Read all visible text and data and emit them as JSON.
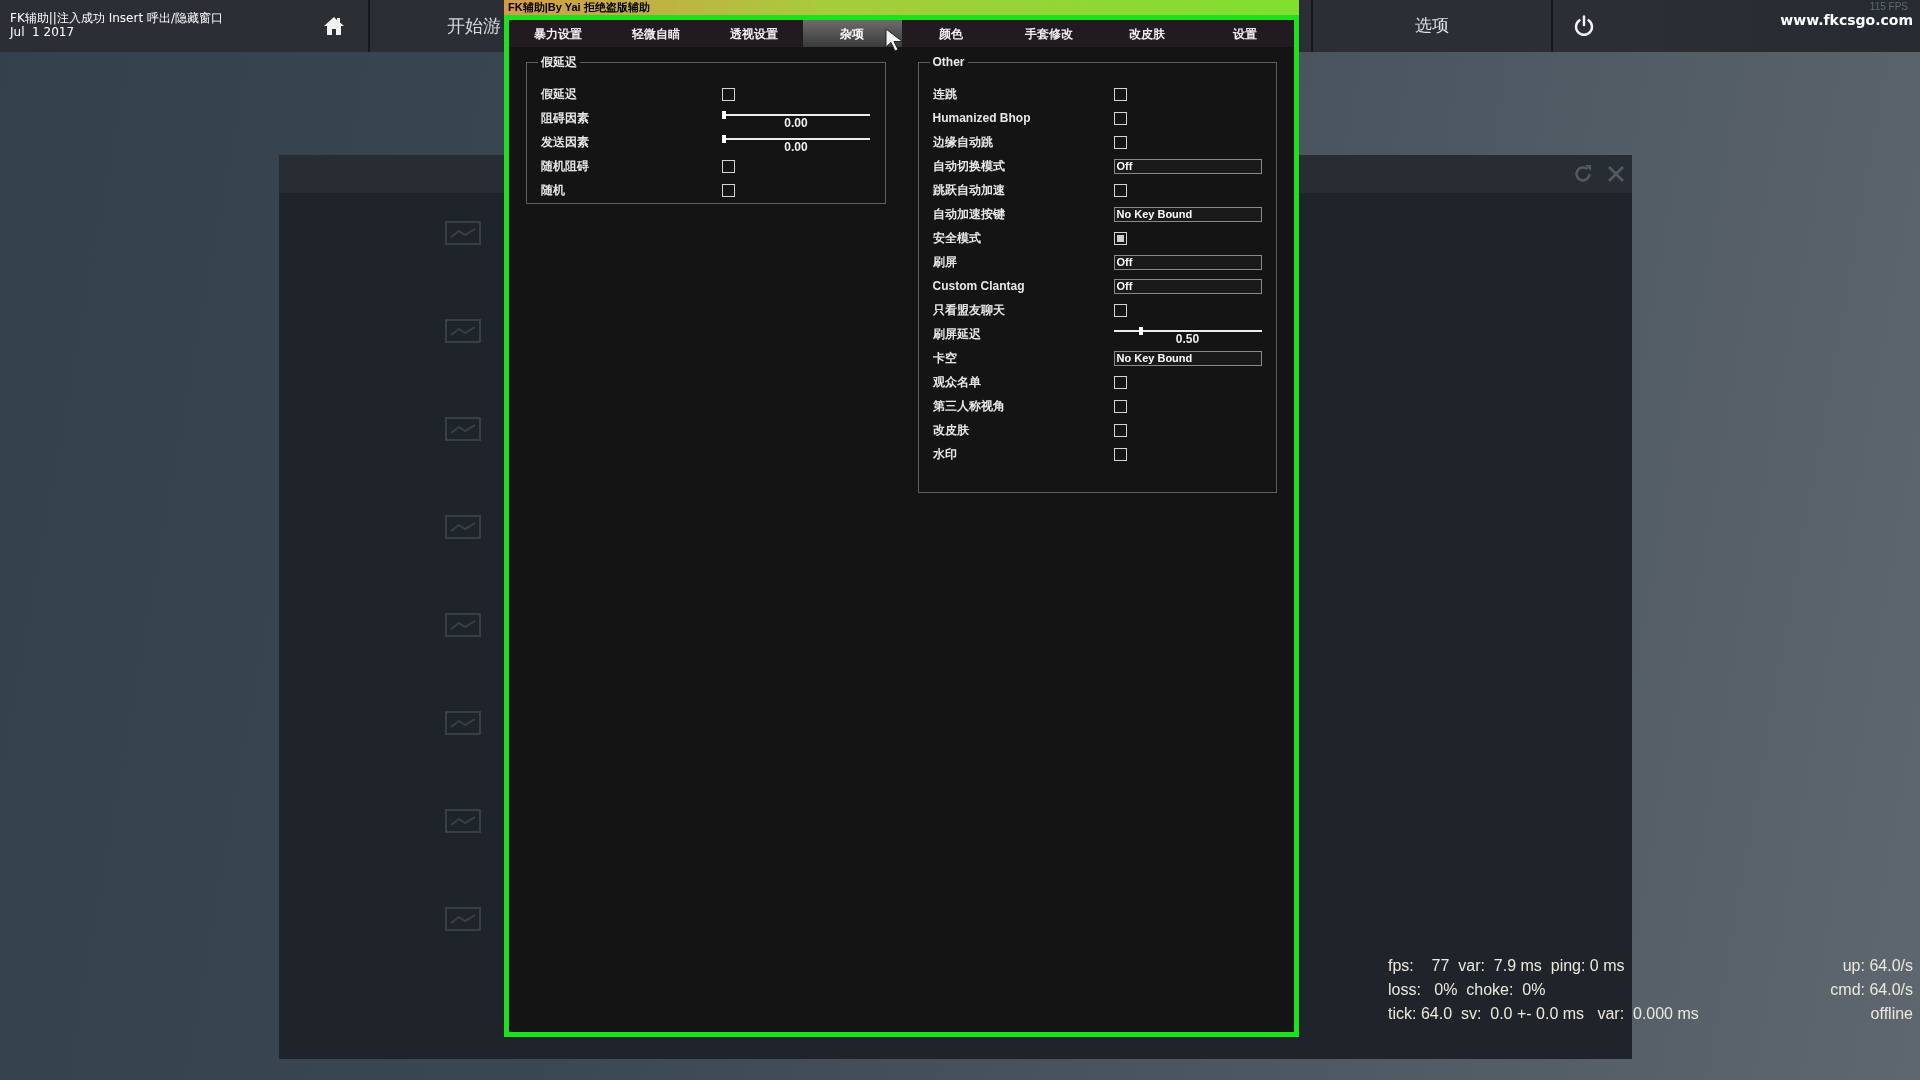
{
  "top_bar": {
    "status_lines": [
      "FK辅助||注入成功 Insert 呼出/隐藏窗口",
      "Jul  1 2017"
    ],
    "play_label": "开始游",
    "options_label": "选项",
    "fps": "115 FPS",
    "site": "www.fkcsgo.com"
  },
  "menu": {
    "title": "FK辅助|By Yai 拒绝盗版辅助",
    "tabs": [
      {
        "label": "暴力设置",
        "selected": false
      },
      {
        "label": "轻微自瞄",
        "selected": false
      },
      {
        "label": "透视设置",
        "selected": false
      },
      {
        "label": "杂项",
        "selected": true
      },
      {
        "label": "颜色",
        "selected": false
      },
      {
        "label": "手套修改",
        "selected": false
      },
      {
        "label": "改皮肤",
        "selected": false
      },
      {
        "label": "设置",
        "selected": false
      }
    ],
    "groups": [
      {
        "title": "假延迟",
        "rows": [
          {
            "label": "假延迟",
            "kind": "checkbox",
            "checked": false
          },
          {
            "label": "阻碍因素",
            "kind": "slider",
            "level": 0,
            "reading": "0.00"
          },
          {
            "label": "发送因素",
            "kind": "slider",
            "level": 0,
            "reading": "0.00"
          },
          {
            "label": "随机阻碍",
            "kind": "checkbox",
            "checked": false
          },
          {
            "label": "随机",
            "kind": "checkbox",
            "checked": false
          }
        ]
      },
      {
        "title": "Other",
        "rows": [
          {
            "label": "连跳",
            "kind": "checkbox",
            "checked": false
          },
          {
            "label": "Humanized Bhop",
            "kind": "checkbox",
            "checked": false
          },
          {
            "label": "边缘自动跳",
            "kind": "checkbox",
            "checked": false
          },
          {
            "label": "自动切换模式",
            "kind": "combo",
            "value": "Off"
          },
          {
            "label": "跳跃自动加速",
            "kind": "checkbox",
            "checked": false
          },
          {
            "label": "自动加速按键",
            "kind": "keybind",
            "value": "No Key Bound"
          },
          {
            "label": "安全模式",
            "kind": "checkbox",
            "checked": true
          },
          {
            "label": "刷屏",
            "kind": "combo",
            "value": "Off"
          },
          {
            "label": "Custom Clantag",
            "kind": "combo",
            "value": "Off"
          },
          {
            "label": "只看盟友聊天",
            "kind": "checkbox",
            "checked": false
          },
          {
            "label": "刷屏延迟",
            "kind": "slider",
            "level": 0.18,
            "reading": "0.50"
          },
          {
            "label": "卡空",
            "kind": "keybind",
            "value": "No Key Bound"
          },
          {
            "label": "观众名单",
            "kind": "checkbox",
            "checked": false
          },
          {
            "label": "第三人称视角",
            "kind": "checkbox",
            "checked": false
          },
          {
            "label": "改皮肤",
            "kind": "checkbox",
            "checked": false
          },
          {
            "label": "水印",
            "kind": "checkbox",
            "checked": false
          }
        ]
      }
    ]
  },
  "net_graph": {
    "left_lines": [
      "fps:    77  var:  7.9 ms  ping: 0 ms",
      "loss:   0%  choke:  0%",
      "tick: 64.0  sv:  0.0 +- 0.0 ms   var:  0.000 ms"
    ],
    "right_lines": [
      "up: 64.0/s",
      "cmd: 64.0/s",
      "offline"
    ]
  }
}
